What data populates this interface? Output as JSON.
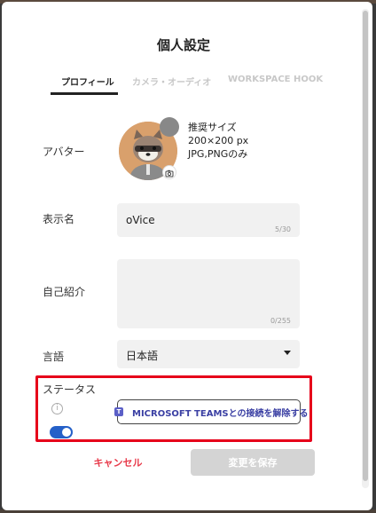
{
  "dialog": {
    "title": "個人設定"
  },
  "tabs": [
    {
      "label": "プロフィール",
      "active": true
    },
    {
      "label": "カメラ・オーディオ",
      "active": false
    },
    {
      "label": "WORKSPACE HOOK",
      "active": false
    }
  ],
  "avatar": {
    "label": "アバター",
    "info": [
      "推奨サイズ",
      "200×200 px",
      "JPG,PNGのみ"
    ]
  },
  "display_name": {
    "label": "表示名",
    "value": "oVice",
    "counter": "5/30"
  },
  "bio": {
    "label": "自己紹介",
    "value": "",
    "counter": "0/255"
  },
  "language": {
    "label": "言語",
    "selected": "日本語"
  },
  "status": {
    "label": "ステータス",
    "toggle_on": true,
    "teams_button_label": "MICROSOFT TEAMSとの接続を解除する"
  },
  "actions": {
    "cancel_label": "キャンセル",
    "save_label": "変更を保存"
  },
  "colors": {
    "accent": "#2560c8",
    "cancel": "#e83a4a",
    "highlight": "#e6001a",
    "teams": "#3a3fa3"
  }
}
